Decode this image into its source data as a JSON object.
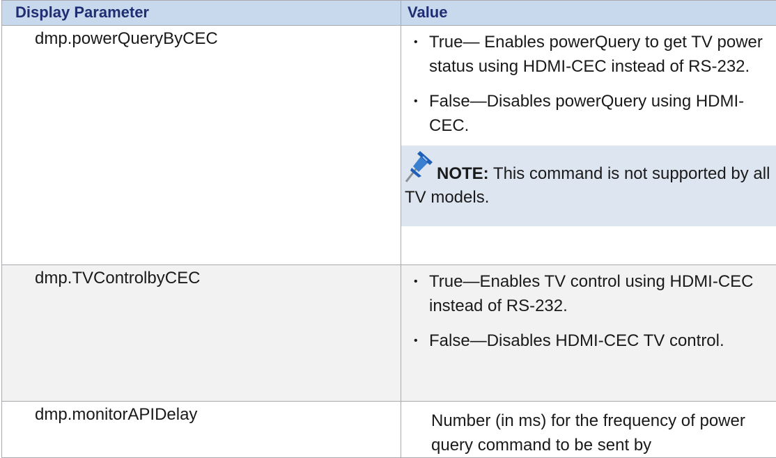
{
  "table": {
    "headers": {
      "param": "Display Parameter",
      "value": "Value"
    },
    "rows": [
      {
        "param": "dmp.powerQueryByCEC",
        "bullets": [
          "True— Enables powerQuery to get TV power status using HDMI-CEC instead of RS-232.",
          "False—Disables powerQuery using HDMI-CEC."
        ],
        "note": {
          "label": "NOTE:",
          "text": "This command is not supported by all TV models."
        }
      },
      {
        "param": "dmp.TVControlbyCEC",
        "bullets": [
          "True—Enables TV control using HDMI-CEC instead of RS-232.",
          "False—Disables HDMI-CEC TV control."
        ]
      },
      {
        "param": "dmp.monitorAPIDelay",
        "value": "Number (in ms) for the frequency of power query command to be sent by"
      }
    ]
  },
  "icons": {
    "note": "pushpin-icon",
    "bullet": "•"
  },
  "colors": {
    "header_bg": "#c8d9ee",
    "header_text": "#1f2e73",
    "note_bg": "#dde5f0",
    "shaded_row_bg": "#f2f2f2",
    "border": "#a7a9ac",
    "pin": "#3a7fd0"
  }
}
